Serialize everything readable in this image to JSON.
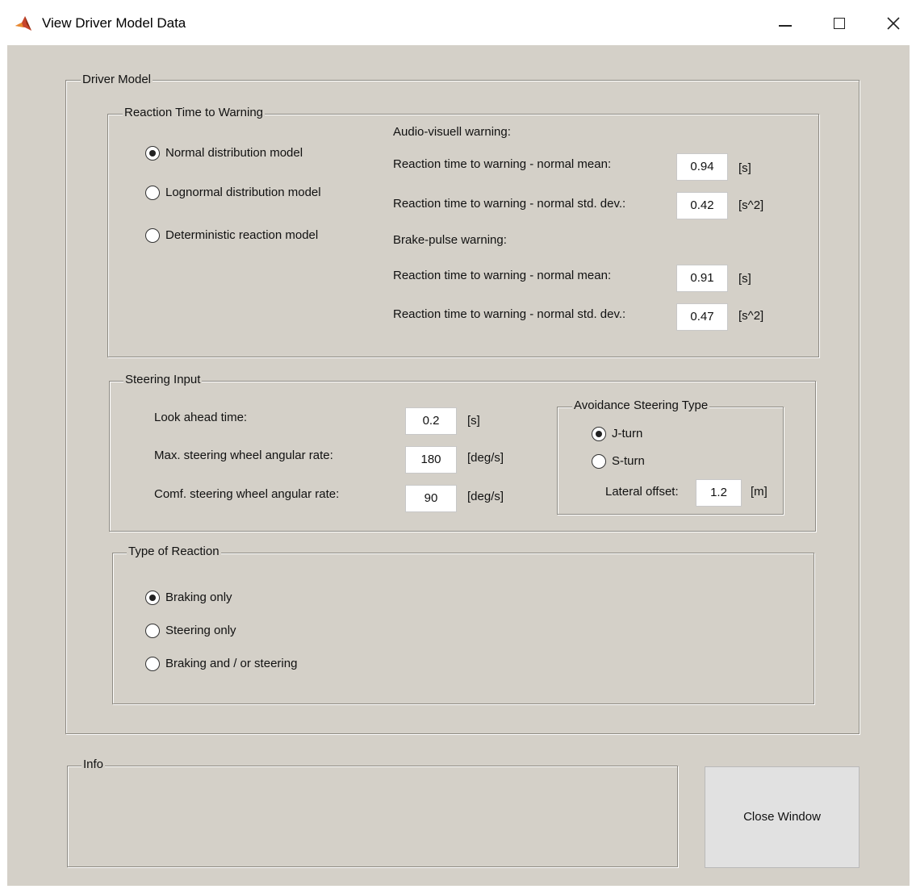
{
  "window": {
    "title": "View Driver Model Data",
    "icon": "matlab-icon"
  },
  "driver_model": {
    "legend": "Driver Model",
    "reaction_time": {
      "legend": "Reaction Time to Warning",
      "options": [
        {
          "label": "Normal distribution model",
          "selected": true
        },
        {
          "label": "Lognormal distribution model",
          "selected": false
        },
        {
          "label": "Deterministic reaction model",
          "selected": false
        }
      ],
      "audio_visual": {
        "heading": "Audio-visuell warning:",
        "mean_label": "Reaction time to warning - normal mean:",
        "mean_value": "0.94",
        "mean_unit": "[s]",
        "std_label": "Reaction time to warning - normal std. dev.:",
        "std_value": "0.42",
        "std_unit": "[s^2]"
      },
      "brake_pulse": {
        "heading": "Brake-pulse warning:",
        "mean_label": "Reaction time to warning - normal mean:",
        "mean_value": "0.91",
        "mean_unit": "[s]",
        "std_label": "Reaction time to warning - normal std. dev.:",
        "std_value": "0.47",
        "std_unit": "[s^2]"
      }
    },
    "steering_input": {
      "legend": "Steering Input",
      "look_ahead_label": "Look ahead time:",
      "look_ahead_value": "0.2",
      "look_ahead_unit": "[s]",
      "max_rate_label": "Max. steering wheel angular rate:",
      "max_rate_value": "180",
      "max_rate_unit": "[deg/s]",
      "comf_rate_label": "Comf. steering wheel angular rate:",
      "comf_rate_value": "90",
      "comf_rate_unit": "[deg/s]",
      "avoidance": {
        "legend": "Avoidance Steering Type",
        "options": [
          {
            "label": "J-turn",
            "selected": true
          },
          {
            "label": "S-turn",
            "selected": false
          }
        ],
        "lateral_offset_label": "Lateral offset:",
        "lateral_offset_value": "1.2",
        "lateral_offset_unit": "[m]"
      }
    },
    "type_of_reaction": {
      "legend": "Type of Reaction",
      "options": [
        {
          "label": "Braking only",
          "selected": true
        },
        {
          "label": "Steering only",
          "selected": false
        },
        {
          "label": "Braking and / or steering",
          "selected": false
        }
      ]
    }
  },
  "info": {
    "legend": "Info",
    "text": ""
  },
  "close_button": {
    "label": "Close Window"
  }
}
